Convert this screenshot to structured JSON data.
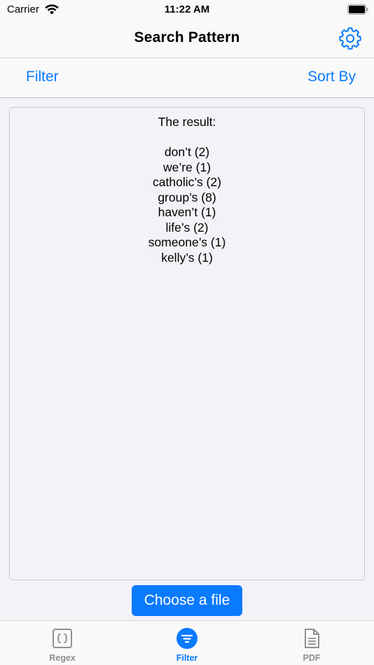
{
  "status_bar": {
    "carrier": "Carrier",
    "time": "11:22 AM"
  },
  "nav": {
    "title": "Search Pattern",
    "settings_icon": "gear-icon"
  },
  "toolbar": {
    "filter_label": "Filter",
    "sort_label": "Sort By"
  },
  "result": {
    "heading": "The result:",
    "lines": [
      "don’t (2)",
      "we’re (1)",
      "catholic’s (2)",
      "group’s (8)",
      "haven’t (1)",
      "life’s (2)",
      "someone’s (1)",
      "kelly’s (1)"
    ]
  },
  "choose_file_label": "Choose a file",
  "tabs": [
    {
      "label": "Regex",
      "icon": "braces-icon"
    },
    {
      "label": "Filter",
      "icon": "filter-icon",
      "selected": true
    },
    {
      "label": "PDF",
      "icon": "document-icon"
    }
  ],
  "colors": {
    "accent": "#0a7aff",
    "inactive_tab": "#8e8e93",
    "background": "#f2f2f7"
  }
}
